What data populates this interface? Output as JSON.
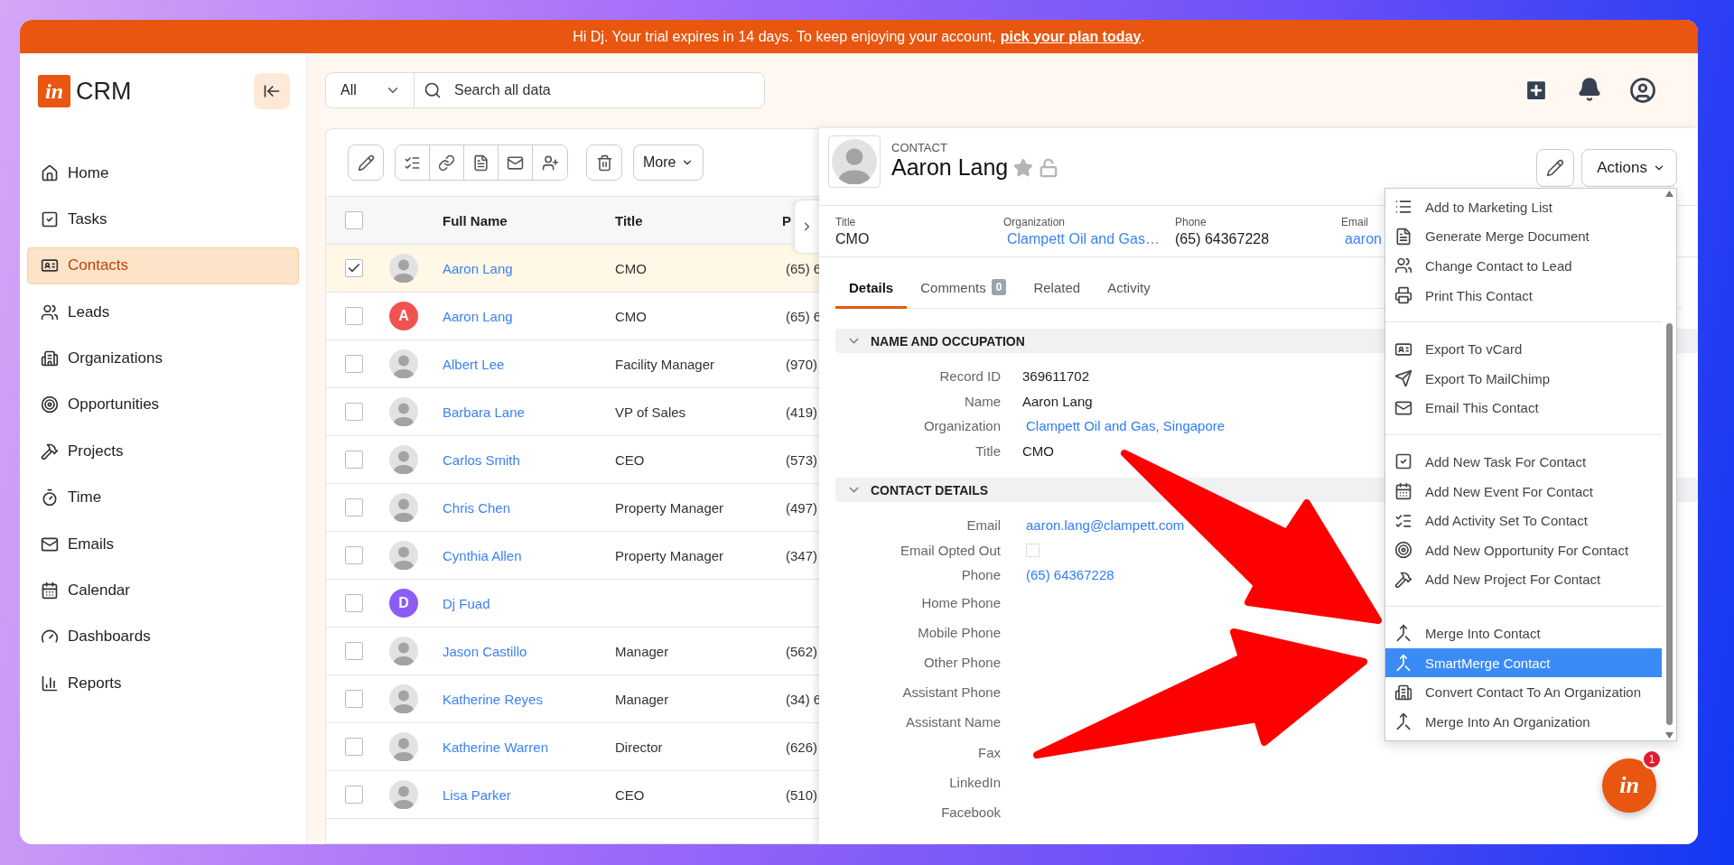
{
  "banner": {
    "text": "Hi Dj. Your trial expires in 14 days. To keep enjoying your account,",
    "link": "pick your plan today",
    "suffix": "."
  },
  "logo": {
    "mark": "in",
    "name": "CRM"
  },
  "sidebar": {
    "items": [
      {
        "label": "Home",
        "kind": "home",
        "selected": false
      },
      {
        "label": "Tasks",
        "kind": "tasks",
        "selected": false
      },
      {
        "label": "Contacts",
        "kind": "contacts",
        "selected": true
      },
      {
        "label": "Leads",
        "kind": "leads",
        "selected": false
      },
      {
        "label": "Organizations",
        "kind": "organizations",
        "selected": false
      },
      {
        "label": "Opportunities",
        "kind": "opportunities",
        "selected": false
      },
      {
        "label": "Projects",
        "kind": "projects",
        "selected": false
      },
      {
        "label": "Time",
        "kind": "time",
        "selected": false
      },
      {
        "label": "Emails",
        "kind": "emails",
        "selected": false
      },
      {
        "label": "Calendar",
        "kind": "calendar",
        "selected": false
      },
      {
        "label": "Dashboards",
        "kind": "dashboards",
        "selected": false
      },
      {
        "label": "Reports",
        "kind": "reports",
        "selected": false
      }
    ]
  },
  "search": {
    "scope": "All",
    "placeholder": "Search all data"
  },
  "toolbar": {
    "more": "More"
  },
  "table": {
    "all_checked": false,
    "columns": [
      "Full Name",
      "Title",
      "P"
    ],
    "rows": [
      {
        "selected": true,
        "checked": true,
        "avatar": {
          "kind": "photo"
        },
        "name": "Aaron Lang",
        "title": "CMO",
        "column_3": "(65) 6"
      },
      {
        "selected": false,
        "checked": false,
        "avatar": {
          "kind": "initial",
          "letter": "A",
          "color": "#f05252"
        },
        "name": "Aaron Lang",
        "title": "CMO",
        "column_3": "(65) 6"
      },
      {
        "selected": false,
        "checked": false,
        "avatar": {
          "kind": "photo"
        },
        "name": "Albert Lee",
        "title": "Facility Manager",
        "column_3": "(970)"
      },
      {
        "selected": false,
        "checked": false,
        "avatar": {
          "kind": "photo"
        },
        "name": "Barbara Lane",
        "title": "VP of Sales",
        "column_3": "(419)"
      },
      {
        "selected": false,
        "checked": false,
        "avatar": {
          "kind": "photo"
        },
        "name": "Carlos Smith",
        "title": "CEO",
        "column_3": "(573)"
      },
      {
        "selected": false,
        "checked": false,
        "avatar": {
          "kind": "photo"
        },
        "name": "Chris Chen",
        "title": "Property Manager",
        "column_3": "(497)"
      },
      {
        "selected": false,
        "checked": false,
        "avatar": {
          "kind": "photo"
        },
        "name": "Cynthia Allen",
        "title": "Property Manager",
        "column_3": "(347)"
      },
      {
        "selected": false,
        "checked": false,
        "avatar": {
          "kind": "initial",
          "letter": "D",
          "color": "#8b5cf6"
        },
        "name": "Dj Fuad"
      },
      {
        "selected": false,
        "checked": false,
        "avatar": {
          "kind": "photo"
        },
        "name": "Jason Castillo",
        "title": "Manager",
        "column_3": "(562)"
      },
      {
        "selected": false,
        "checked": false,
        "avatar": {
          "kind": "photo"
        },
        "name": "Katherine Reyes",
        "title": "Manager",
        "column_3": "(34) 6"
      },
      {
        "selected": false,
        "checked": false,
        "avatar": {
          "kind": "photo"
        },
        "name": "Katherine Warren",
        "title": "Director",
        "column_3": "(626)"
      },
      {
        "selected": false,
        "checked": false,
        "avatar": {
          "kind": "photo"
        },
        "name": "Lisa Parker",
        "title": "CEO",
        "column_3": "(510)"
      }
    ]
  },
  "detail": {
    "type_label": "CONTACT",
    "name": "Aaron Lang",
    "summary": [
      {
        "label": "Title",
        "value": "CMO",
        "kind": "text"
      },
      {
        "label": "Organization",
        "value": "Clampett Oil and Gas…",
        "kind": "link"
      },
      {
        "label": "Phone",
        "value": "(65) 64367228",
        "kind": "text"
      },
      {
        "label": "Email",
        "value": "aaron",
        "kind": "link"
      }
    ],
    "tabs": [
      {
        "label": "Details",
        "selected": true
      },
      {
        "label": "Comments",
        "count": "0",
        "selected": false
      },
      {
        "label": "Related",
        "selected": false
      },
      {
        "label": "Activity",
        "selected": false
      }
    ],
    "sections": [
      {
        "title": "NAME AND OCCUPATION",
        "expanded": true,
        "fields": [
          {
            "label": "Record ID",
            "value": "369611702",
            "kind": "text"
          },
          {
            "label": "Name",
            "value": "Aaron Lang",
            "kind": "text"
          },
          {
            "label": "Organization",
            "value": "Clampett Oil and Gas, Singapore",
            "kind": "link"
          },
          {
            "label": "Title",
            "value": "CMO",
            "kind": "text"
          }
        ]
      },
      {
        "title": "CONTACT DETAILS",
        "expanded": true,
        "fields": [
          {
            "label": "Email",
            "value": "aaron.lang@clampett.com",
            "kind": "link"
          },
          {
            "label": "Email Opted Out",
            "kind": "checkbox",
            "checked": false
          },
          {
            "label": "Phone",
            "value": "(65) 64367228",
            "kind": "link"
          },
          {
            "label": "Home Phone",
            "kind": "text"
          },
          {
            "label": "Mobile Phone",
            "kind": "text"
          },
          {
            "label": "Other Phone",
            "kind": "text"
          },
          {
            "label": "Assistant Phone",
            "kind": "text"
          },
          {
            "label": "Assistant Name",
            "kind": "text"
          },
          {
            "label": "Fax",
            "kind": "text"
          },
          {
            "label": "LinkedIn",
            "kind": "text"
          },
          {
            "label": "Facebook",
            "kind": "text"
          }
        ]
      }
    ]
  },
  "actions": {
    "button": "Actions",
    "groups": [
      {
        "items": [
          {
            "label": "Add to Marketing List",
            "kind": "list",
            "selected": false
          },
          {
            "label": "Generate Merge Document",
            "kind": "document",
            "selected": false
          },
          {
            "label": "Change Contact to Lead",
            "kind": "people",
            "selected": false
          },
          {
            "label": "Print This Contact",
            "kind": "print",
            "selected": false
          }
        ]
      },
      {
        "items": [
          {
            "label": "Export To vCard",
            "kind": "card",
            "selected": false
          },
          {
            "label": "Export To MailChimp",
            "kind": "send",
            "selected": false
          },
          {
            "label": "Email This Contact",
            "kind": "mail",
            "selected": false
          }
        ]
      },
      {
        "items": [
          {
            "label": "Add New Task For Contact",
            "kind": "task",
            "selected": false
          },
          {
            "label": "Add New Event For Contact",
            "kind": "calendar",
            "selected": false
          },
          {
            "label": "Add Activity Set To Contact",
            "kind": "checklist",
            "selected": false
          },
          {
            "label": "Add New Opportunity For Contact",
            "kind": "target",
            "selected": false
          },
          {
            "label": "Add New Project For Contact",
            "kind": "hammer",
            "selected": false
          }
        ]
      },
      {
        "items": [
          {
            "label": "Merge Into Contact",
            "kind": "merge",
            "selected": false
          },
          {
            "label": "SmartMerge Contact",
            "kind": "merge",
            "selected": true
          },
          {
            "label": "Convert Contact To An Organization",
            "kind": "building",
            "selected": false
          },
          {
            "label": "Merge Into An Organization",
            "kind": "merge",
            "selected": false
          }
        ]
      }
    ]
  },
  "chat": {
    "mark": "in",
    "badge": "1"
  }
}
